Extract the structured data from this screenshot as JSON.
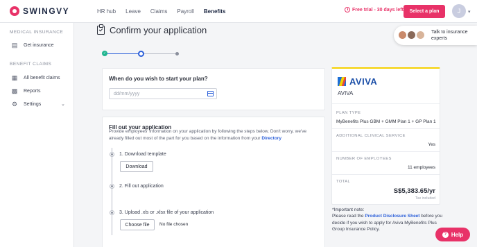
{
  "brand": {
    "name": "SWINGVY",
    "accent": "#e83268"
  },
  "nav": {
    "items": [
      "HR hub",
      "Leave",
      "Claims",
      "Payroll",
      "Benefits"
    ],
    "active": "Benefits"
  },
  "header": {
    "trial_text": "Free trial - 30 days left",
    "select_plan_label": "Select a plan",
    "avatar_initial": "J"
  },
  "sidebar": {
    "medical_heading": "MEDICAL INSURANCE",
    "get_insurance": "Get insurance",
    "benefit_heading": "BENEFIT CLAIMS",
    "all_claims": "All benefit claims",
    "reports": "Reports",
    "settings": "Settings"
  },
  "page": {
    "title": "Confirm your application",
    "current_step": 2,
    "total_steps": 3
  },
  "start_card": {
    "question": "When do you wish to start your plan?",
    "date_placeholder": "dd/mm/yyyy"
  },
  "fill_card": {
    "title": "Fill out your application",
    "description": "Provide employees' information on your application by following the steps below. Don't worry, we've already filled out most of the part for you based on the information from your",
    "directory_link": "Directory",
    "step1": "1. Download template",
    "download_label": "Download",
    "step2": "2. Fill out application",
    "step3": "3. Upload .xls or .xlsx file of your application",
    "choose_file_label": "Choose file",
    "no_file": "No file chosen"
  },
  "plan_card": {
    "insurer_logo_text": "AVIVA",
    "insurer_name": "AVIVA",
    "plan_type_label": "PLAN TYPE",
    "plan_type": "MyBenefits Plus GBM + GMM Plan 1 + GP Plan 1",
    "clinical_label": "ADDITIONAL CLINICAL SERVICE",
    "clinical_value": "Yes",
    "employees_label": "NUMBER OF EMPLOYEES",
    "employees_value": "11 employees",
    "total_label": "TOTAL",
    "total_value": "S$5,383.65/yr",
    "tax_note": "Tax included"
  },
  "note": {
    "heading": "*Important note:",
    "before": "Please read the",
    "link": "Product Disclosure Sheet",
    "after": "before you decide if you wish to apply for Aviva MyBenefits Plus Group Insurance Policy."
  },
  "talk_widget": {
    "text_line1": "Talk to insurance",
    "text_line2": "experts"
  },
  "help": {
    "label": "Help"
  }
}
